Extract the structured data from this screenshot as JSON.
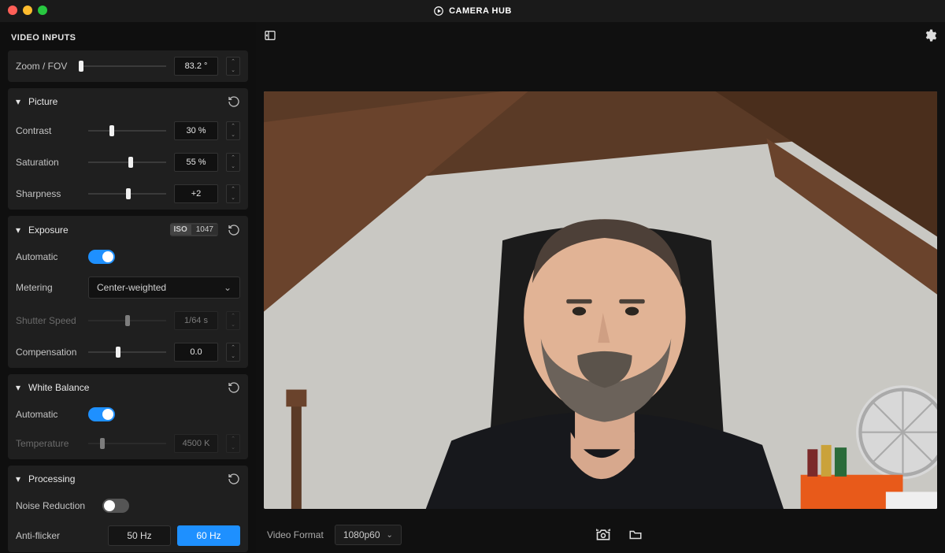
{
  "app": {
    "title": "CAMERA HUB"
  },
  "sidebar": {
    "header": "VIDEO INPUTS",
    "zoom": {
      "label": "Zoom / FOV",
      "value": "83.2 °",
      "percent": 3
    },
    "picture": {
      "title": "Picture",
      "contrast": {
        "label": "Contrast",
        "value": "30 %",
        "percent": 30
      },
      "saturation": {
        "label": "Saturation",
        "value": "55 %",
        "percent": 55
      },
      "sharpness": {
        "label": "Sharpness",
        "value": "+2",
        "percent": 52
      }
    },
    "exposure": {
      "title": "Exposure",
      "isoLabel": "ISO",
      "isoValue": "1047",
      "automatic": {
        "label": "Automatic",
        "on": true
      },
      "metering": {
        "label": "Metering",
        "value": "Center-weighted"
      },
      "shutter": {
        "label": "Shutter Speed",
        "value": "1/64 s",
        "percent": 50
      },
      "compensation": {
        "label": "Compensation",
        "value": "0.0",
        "percent": 38
      }
    },
    "wb": {
      "title": "White Balance",
      "automatic": {
        "label": "Automatic",
        "on": true
      },
      "temperature": {
        "label": "Temperature",
        "value": "4500 K",
        "percent": 18
      }
    },
    "proc": {
      "title": "Processing",
      "noise": {
        "label": "Noise Reduction",
        "on": false
      },
      "antiflicker": {
        "label": "Anti-flicker",
        "opt50": "50 Hz",
        "opt60": "60 Hz",
        "active": "60"
      }
    }
  },
  "footer": {
    "formatLabel": "Video Format",
    "formatValue": "1080p60"
  }
}
